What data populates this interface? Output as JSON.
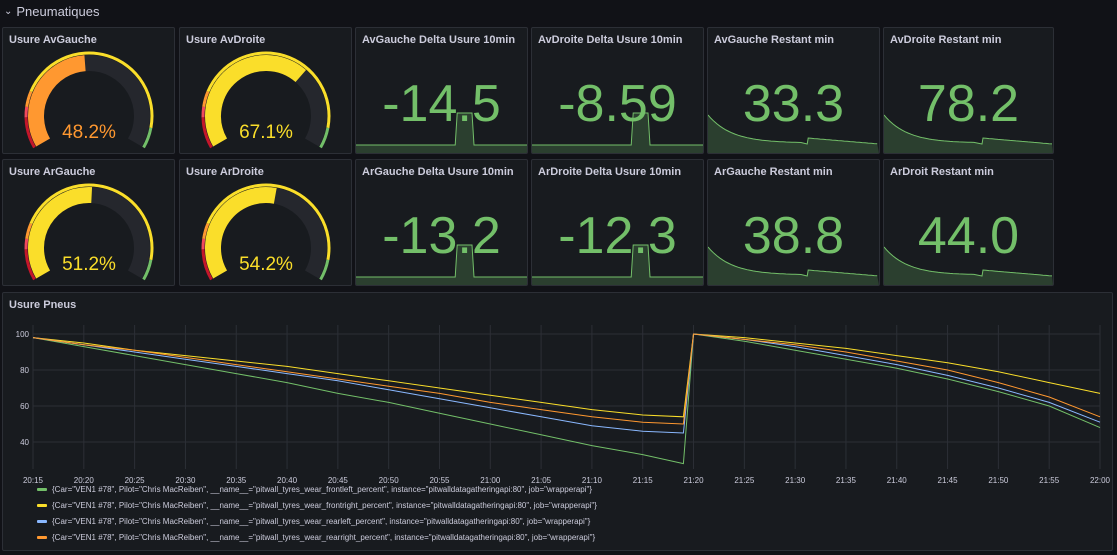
{
  "row": {
    "title": "Pneumatiques"
  },
  "gauges": [
    {
      "title": "Usure AvGauche",
      "value": 48.2,
      "display": "48.2%",
      "color": "#ff9830"
    },
    {
      "title": "Usure AvDroite",
      "value": 67.1,
      "display": "67.1%",
      "color": "#fade2a"
    },
    {
      "title": "Usure ArGauche",
      "value": 51.2,
      "display": "51.2%",
      "color": "#fade2a"
    },
    {
      "title": "Usure ArDroite",
      "value": 54.2,
      "display": "54.2%",
      "color": "#fade2a"
    }
  ],
  "stats": [
    {
      "title": "AvGauche Delta Usure 10min",
      "value": "-14.5",
      "spark": "spike"
    },
    {
      "title": "AvDroite Delta Usure 10min",
      "value": "-8.59",
      "spark": "spike"
    },
    {
      "title": "AvGauche Restant min",
      "value": "33.3",
      "spark": "decay"
    },
    {
      "title": "AvDroite Restant min",
      "value": "78.2",
      "spark": "decay"
    },
    {
      "title": "ArGauche Delta Usure 10min",
      "value": "-13.2",
      "spark": "spike"
    },
    {
      "title": "ArDroite Delta Usure 10min",
      "value": "-12.3",
      "spark": "spike"
    },
    {
      "title": "ArGauche Restant min",
      "value": "38.8",
      "spark": "decay"
    },
    {
      "title": "ArDroit Restant min",
      "value": "44.0",
      "spark": "decay"
    }
  ],
  "colors": {
    "stat_green": "#73bf69",
    "panel_bg": "#181b1f",
    "grid": "#2c2f36"
  },
  "timeseries": {
    "title": "Usure Pneus",
    "legend": [
      "{Car=\"VEN1 #78\", Pilot=\"Chris MacReiben\", __name__=\"pitwall_tyres_wear_frontleft_percent\", instance=\"pitwalldatagatheringapi:80\", job=\"wrapperapi\"}",
      "{Car=\"VEN1 #78\", Pilot=\"Chris MacReiben\", __name__=\"pitwall_tyres_wear_frontright_percent\", instance=\"pitwalldatagatheringapi:80\", job=\"wrapperapi\"}",
      "{Car=\"VEN1 #78\", Pilot=\"Chris MacReiben\", __name__=\"pitwall_tyres_wear_rearleft_percent\", instance=\"pitwalldatagatheringapi:80\", job=\"wrapperapi\"}",
      "{Car=\"VEN1 #78\", Pilot=\"Chris MacReiben\", __name__=\"pitwall_tyres_wear_rearright_percent\", instance=\"pitwalldatagatheringapi:80\", job=\"wrapperapi\"}"
    ]
  },
  "chart_data": {
    "type": "line",
    "title": "Usure Pneus",
    "xlabel": "",
    "ylabel": "",
    "ylim": [
      25,
      105
    ],
    "yticks": [
      40,
      60,
      80,
      100
    ],
    "xticks": [
      "20:15",
      "20:20",
      "20:25",
      "20:30",
      "20:35",
      "20:40",
      "20:45",
      "20:50",
      "20:55",
      "21:00",
      "21:05",
      "21:10",
      "21:15",
      "21:20",
      "21:25",
      "21:30",
      "21:35",
      "21:40",
      "21:45",
      "21:50",
      "21:55",
      "22:00"
    ],
    "x": [
      "20:15",
      "20:20",
      "20:25",
      "20:30",
      "20:35",
      "20:40",
      "20:45",
      "20:50",
      "20:55",
      "21:00",
      "21:05",
      "21:10",
      "21:15",
      "21:19",
      "21:20",
      "21:25",
      "21:30",
      "21:35",
      "21:40",
      "21:45",
      "21:50",
      "21:55",
      "22:00"
    ],
    "grid": true,
    "legend_position": "bottom",
    "series": [
      {
        "name": "{Car=\"VEN1 #78\", Pilot=\"Chris MacReiben\", __name__=\"pitwall_tyres_wear_frontleft_percent\", instance=\"pitwalldatagatheringapi:80\", job=\"wrapperapi\"}",
        "color": "#73bf69",
        "values": [
          98,
          93,
          88,
          83,
          78,
          73,
          67,
          62,
          56,
          50,
          44,
          38,
          33,
          28,
          100,
          96,
          91,
          86,
          81,
          75,
          68,
          60,
          48
        ]
      },
      {
        "name": "{Car=\"VEN1 #78\", Pilot=\"Chris MacReiben\", __name__=\"pitwall_tyres_wear_frontright_percent\", instance=\"pitwalldatagatheringapi:80\", job=\"wrapperapi\"}",
        "color": "#fade2a",
        "values": [
          98,
          95,
          91,
          88,
          85,
          82,
          78,
          74,
          70,
          66,
          62,
          58,
          55,
          54,
          100,
          98,
          95,
          92,
          88,
          84,
          79,
          73,
          67
        ]
      },
      {
        "name": "{Car=\"VEN1 #78\", Pilot=\"Chris MacReiben\", __name__=\"pitwall_tyres_wear_rearleft_percent\", instance=\"pitwalldatagatheringapi:80\", job=\"wrapperapi\"}",
        "color": "#8ab8ff",
        "values": [
          98,
          94,
          90,
          86,
          82,
          78,
          74,
          69,
          64,
          59,
          54,
          49,
          46,
          45,
          100,
          97,
          93,
          88,
          83,
          77,
          70,
          62,
          51
        ]
      },
      {
        "name": "{Car=\"VEN1 #78\", Pilot=\"Chris MacReiben\", __name__=\"pitwall_tyres_wear_rearright_percent\", instance=\"pitwalldatagatheringapi:80\", job=\"wrapperapi\"}",
        "color": "#ff9830",
        "values": [
          98,
          94,
          91,
          87,
          83,
          79,
          75,
          71,
          67,
          62,
          58,
          54,
          51,
          50,
          100,
          97,
          94,
          90,
          85,
          80,
          73,
          65,
          54
        ]
      }
    ]
  }
}
